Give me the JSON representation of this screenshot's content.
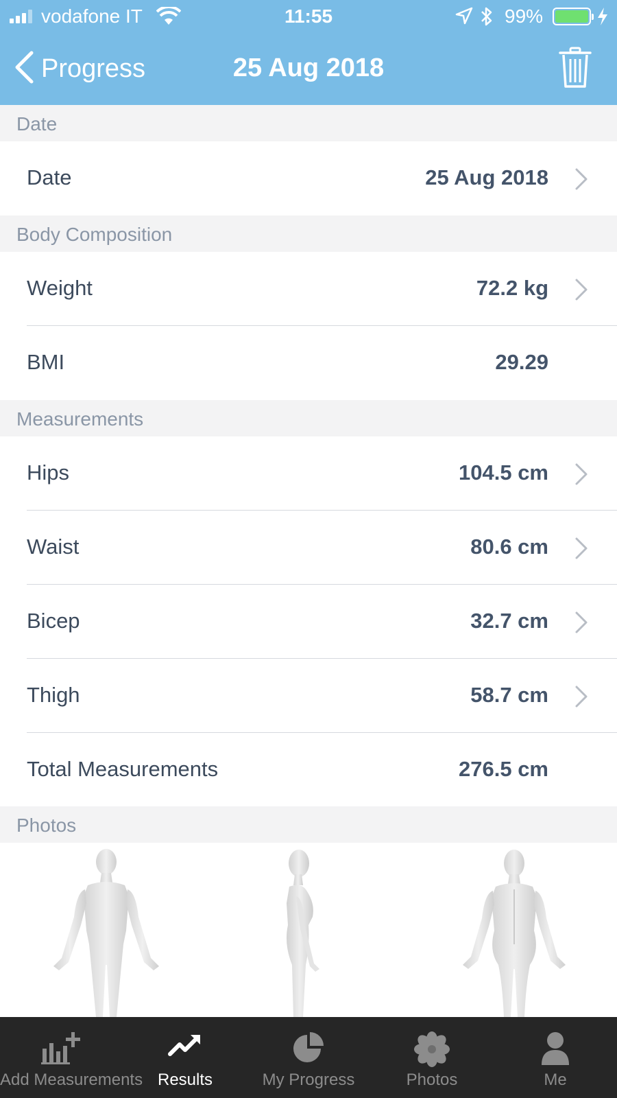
{
  "status_bar": {
    "carrier": "vodafone IT",
    "time": "11:55",
    "battery": "99%"
  },
  "nav": {
    "back_label": "Progress",
    "title": "25 Aug 2018"
  },
  "sections": {
    "date": {
      "header": "Date",
      "rows": [
        {
          "label": "Date",
          "value": "25 Aug 2018"
        }
      ]
    },
    "body": {
      "header": "Body Composition",
      "rows": [
        {
          "label": "Weight",
          "value": "72.2 kg"
        },
        {
          "label": "BMI",
          "value": "29.29"
        }
      ]
    },
    "measurements": {
      "header": "Measurements",
      "rows": [
        {
          "label": "Hips",
          "value": "104.5 cm"
        },
        {
          "label": "Waist",
          "value": "80.6 cm"
        },
        {
          "label": "Bicep",
          "value": "32.7 cm"
        },
        {
          "label": "Thigh",
          "value": "58.7 cm"
        },
        {
          "label": "Total Measurements",
          "value": "276.5 cm"
        }
      ]
    },
    "photos": {
      "header": "Photos"
    }
  },
  "tabs": [
    {
      "label": "Add Measurements",
      "icon": "add-measurements-icon"
    },
    {
      "label": "Results",
      "icon": "trend-up-icon",
      "active": true
    },
    {
      "label": "My Progress",
      "icon": "pie-chart-icon"
    },
    {
      "label": "Photos",
      "icon": "flower-icon"
    },
    {
      "label": "Me",
      "icon": "person-icon"
    }
  ],
  "colors": {
    "nav_bg": "#79bce6",
    "battery_green": "#6fe070",
    "tabbar_bg": "#262626"
  }
}
